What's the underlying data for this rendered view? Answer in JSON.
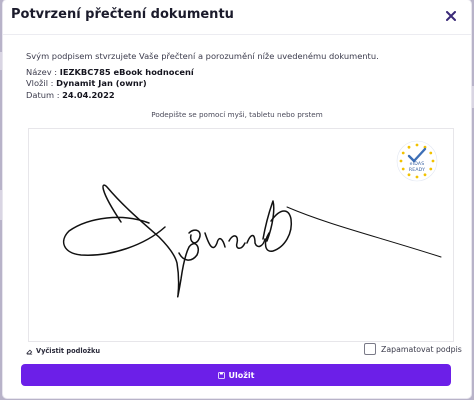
{
  "modal": {
    "title": "Potvrzení přečtení dokumentu"
  },
  "info": {
    "lead": "Svým podpisem stvrzujete Vaše přečtení a porozumění níže uvedenému dokumentu.",
    "name_label": "Název :",
    "name_value": "IEZKBC785 eBook hodnocení",
    "uploaded_label": "Vložil :",
    "uploaded_value": "Dynamit Jan (ownr)",
    "date_label": "Datum :",
    "date_value": "24.04.2022"
  },
  "signature": {
    "hint": "Podepište se pomocí myši, tabletu nebo prstem",
    "badge_line1": "eIDAS",
    "badge_line2": "READY"
  },
  "actions": {
    "clear_label": "Vyčistit podložku",
    "remember_label": "Zapamatovat podpis",
    "remember_checked": false,
    "save_label": "Uložit"
  },
  "colors": {
    "accent": "#6c1fe8",
    "badge_blue": "#3d6fb6",
    "badge_star": "#f2c200"
  },
  "icons": {
    "close": "close-icon",
    "clear": "eraser-icon",
    "save": "save-icon",
    "badge": "eidas-badge-icon"
  }
}
